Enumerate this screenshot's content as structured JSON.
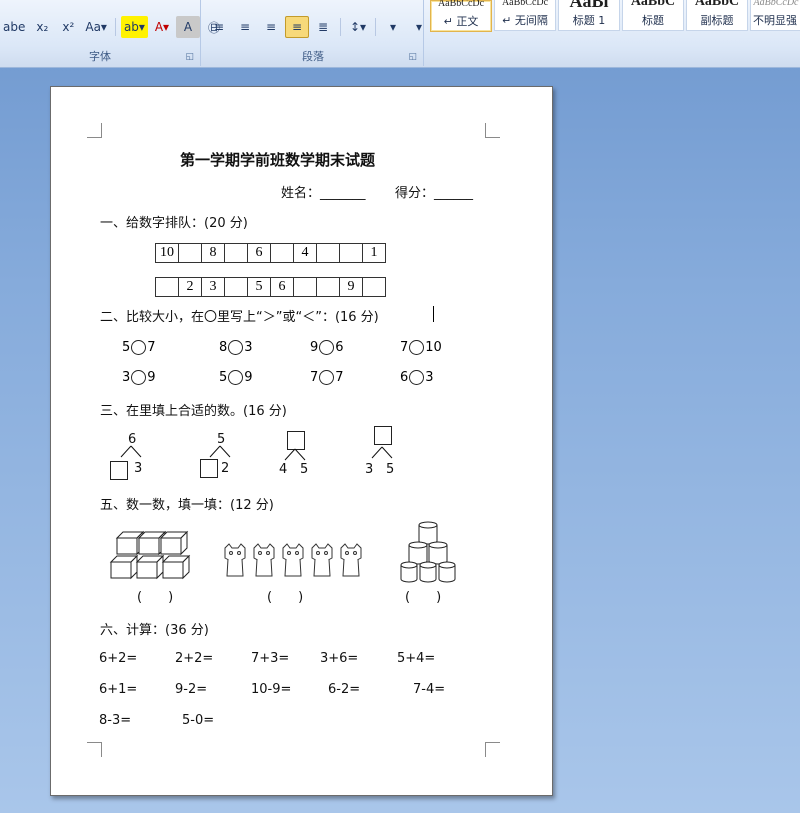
{
  "ribbon": {
    "font_group_label": "字体",
    "paragraph_group_label": "段落",
    "font_buttons": [
      "abe",
      "x₂",
      "x²",
      "Aa▾",
      "ab▾",
      "A▾",
      "A",
      "㊐"
    ],
    "paragraph_buttons": [
      "≡",
      "≡",
      "≡",
      "≡",
      "≣",
      "↕▾",
      "▾",
      "▾"
    ],
    "styles": [
      {
        "sample": "AaBbCcDc",
        "name": "↵ 正文"
      },
      {
        "sample": "AaBbCcDc",
        "name": "↵ 无间隔"
      },
      {
        "sample": "AaBl",
        "name": "标题 1"
      },
      {
        "sample": "AaBbC",
        "name": "标题"
      },
      {
        "sample": "AaBbC",
        "name": "副标题"
      },
      {
        "sample": "AaBbCcDc",
        "name": "不明显强"
      }
    ]
  },
  "doc": {
    "title": "第一学期学前班数学期末试题",
    "name_label": "姓名：_______",
    "score_label": "得分：______",
    "s1": {
      "heading": "一、给数字排队：(20 分)",
      "row1": [
        "10",
        "",
        "8",
        "",
        "6",
        "",
        "4",
        "",
        "",
        "1"
      ],
      "row2": [
        "",
        "2",
        "3",
        "",
        "5",
        "6",
        "",
        "",
        "9",
        ""
      ]
    },
    "s2": {
      "heading": "二、比较大小，在〇里写上“＞”或“＜”：(16 分)",
      "items": [
        [
          "5",
          "7"
        ],
        [
          "8",
          "3"
        ],
        [
          "9",
          "6"
        ],
        [
          "7",
          "10"
        ],
        [
          "3",
          "9"
        ],
        [
          "5",
          "9"
        ],
        [
          "7",
          "7"
        ],
        [
          "6",
          "3"
        ]
      ]
    },
    "s3": {
      "heading": "三、在里填上合适的数。(16 分)",
      "trees": [
        {
          "top": "6",
          "left": "",
          "right": "3"
        },
        {
          "top": "5",
          "left": "",
          "right": "2"
        },
        {
          "top": "",
          "left": "4",
          "right": "5"
        },
        {
          "top": "",
          "left": "3",
          "right": "5"
        }
      ]
    },
    "s5": {
      "heading": "五、数一数，填一填：(12 分)",
      "answers": [
        "(　　)",
        "(　　)",
        "(　　)"
      ]
    },
    "s6": {
      "heading": "六、计算：(36 分)",
      "row1": [
        "6+2=",
        "2+2=",
        "7+3=",
        "3+6=",
        "5+4="
      ],
      "row2": [
        "6+1=",
        "9-2=",
        "10-9=",
        "6-2=",
        "7-4="
      ],
      "row3": [
        "8-3=",
        "5-0="
      ]
    }
  }
}
